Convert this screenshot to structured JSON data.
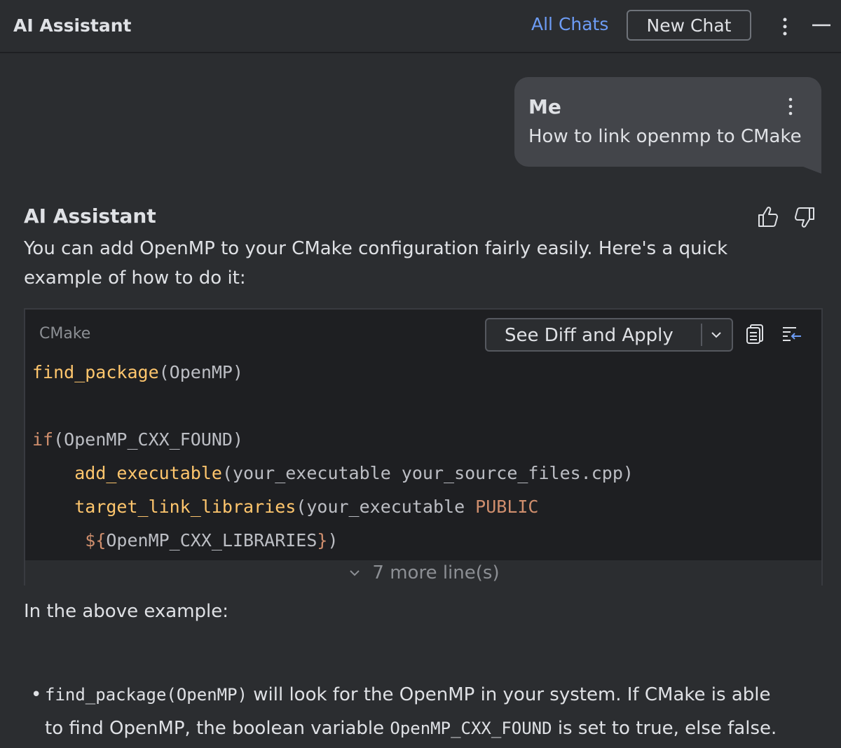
{
  "header": {
    "title": "AI Assistant",
    "all_chats": "All Chats",
    "new_chat": "New Chat"
  },
  "user_message": {
    "author": "Me",
    "text": "How to link openmp to CMake"
  },
  "assistant_message": {
    "author": "AI Assistant",
    "intro_line1": "You can add OpenMP to your CMake configuration fairly easily. Here's a quick",
    "intro_line2": "example of how to do it:",
    "code": {
      "language": "CMake",
      "apply_button": "See Diff and Apply",
      "lines": [
        {
          "fn": "find_package",
          "rest": "(OpenMP)"
        },
        {
          "fn": "",
          "rest": ""
        },
        {
          "kw": "if",
          "rest": "(OpenMP_CXX_FOUND)"
        },
        {
          "indent": "    ",
          "fn": "add_executable",
          "rest": "(your_executable your_source_files.cpp)"
        },
        {
          "indent": "    ",
          "fn": "target_link_libraries",
          "rest": "(your_executable ",
          "kw2": "PUBLIC"
        },
        {
          "indent": "     ",
          "kw": "${",
          "rest": "OpenMP_CXX_LIBRARIES",
          "kw2": "}",
          "tail": ")"
        }
      ],
      "more_lines": "7 more line(s)"
    },
    "after_text": "In the above example:",
    "bullets": [
      {
        "code1": "find_package(OpenMP)",
        "text1": " will look for the OpenMP in your system. If CMake is able",
        "text2": "to find OpenMP, the boolean variable ",
        "code2": "OpenMP_CXX_FOUND",
        "text3": " is set to true, else false."
      }
    ]
  },
  "colors": {
    "background": "#2b2d30",
    "accent_link": "#6d9cf5",
    "code_function": "#ffc66d",
    "code_keyword": "#cf8e6d"
  },
  "icons": [
    "more-vertical-icon",
    "minimize-icon",
    "thumbs-up-icon",
    "thumbs-down-icon",
    "copy-icon",
    "insert-icon",
    "chevron-down-icon"
  ]
}
